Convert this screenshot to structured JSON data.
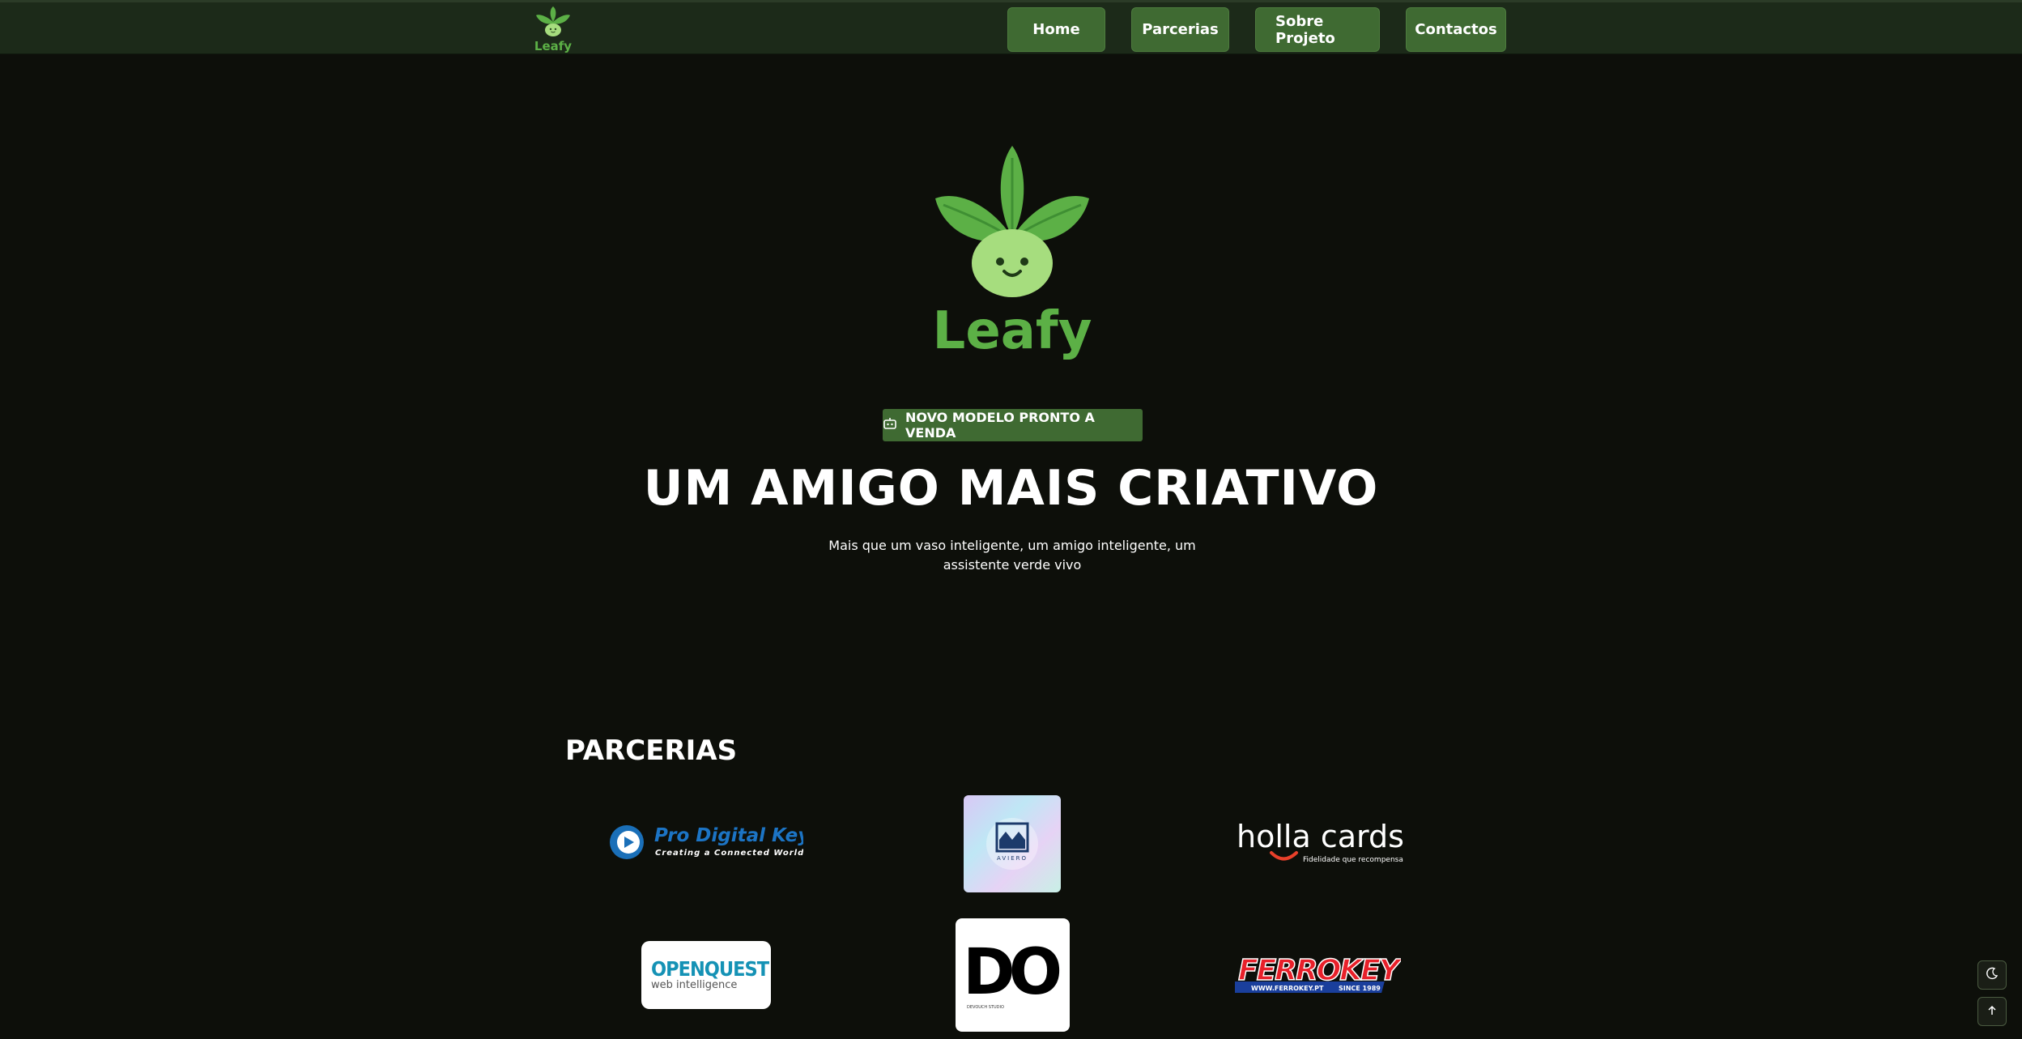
{
  "brand": {
    "name": "Leafy",
    "colors": {
      "leaf": "#5cb046",
      "leaf_dark": "#3f8f33",
      "bulb": "#a6dd7e",
      "text": "#5cb046"
    }
  },
  "nav": {
    "items": [
      {
        "label": "Home"
      },
      {
        "label": "Parcerias"
      },
      {
        "label": "Sobre Projeto"
      },
      {
        "label": "Contactos"
      }
    ],
    "button_color": "#3f6a32"
  },
  "hero": {
    "badge": {
      "icon": "robot-icon",
      "label": "NOVO MODELO PRONTO A VENDA"
    },
    "title": "UM AMIGO MAIS CRIATIVO",
    "subtitle": "Mais que um vaso inteligente, um amigo inteligente, um assistente verde vivo"
  },
  "partners": {
    "title": "PARCERIAS",
    "items": [
      {
        "name": "Pro Digital Key",
        "tagline": "Creating a Connected World"
      },
      {
        "name": "AVIERO"
      },
      {
        "name": "holla cards",
        "tagline": "Fidelidade que recompensa"
      },
      {
        "name": "OPENQUEST",
        "tagline": "web intelligence"
      },
      {
        "name": "DO",
        "tagline": "DEVOUCH STUDIO"
      },
      {
        "name": "FERROKEY",
        "tagline_left": "WWW.FERROKEY.PT",
        "tagline_right": "SINCE 1989"
      }
    ]
  },
  "floating": {
    "theme_toggle_icon": "moon-icon",
    "scroll_top_icon": "arrow-up-icon"
  }
}
